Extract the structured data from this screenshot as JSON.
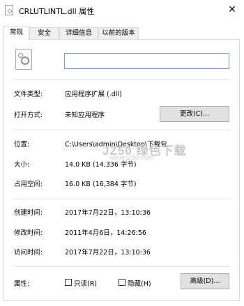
{
  "window": {
    "title": "CRLUTLINTL.dll 属性",
    "close_label": "✕",
    "close_icon": "close-icon"
  },
  "tabs": [
    {
      "label": "常规",
      "active": true
    },
    {
      "label": "安全"
    },
    {
      "label": "详细信息"
    },
    {
      "label": "以前的版本"
    }
  ],
  "general": {
    "file_icon": "settings-file-icon",
    "name_value": "",
    "rows": {
      "type": {
        "label": "文件类型:",
        "value": "应用程序扩展 (.dll)"
      },
      "opens_with": {
        "label": "打开方式:",
        "value": "未知应用程序",
        "button": "更改(C)..."
      },
      "location": {
        "label": "位置:",
        "value": "C:\\Users\\admin\\Desktop\\下载包"
      },
      "size": {
        "label": "大小:",
        "value": "14.0 KB (14,336 字节)"
      },
      "size_on_disk": {
        "label": "占用空间:",
        "value": "16.0 KB (16,384 字节)"
      },
      "created": {
        "label": "创建时间:",
        "value": "2017年7月22日，13:10:36"
      },
      "modified": {
        "label": "修改时间:",
        "value": "2011年4月6日，14:26:56"
      },
      "accessed": {
        "label": "访问时间:",
        "value": "2017年7月22日，13:10:36"
      }
    },
    "attributes": {
      "label": "属性:",
      "readonly": "只读(R)",
      "readonly_checked": false,
      "hidden": "隐藏(H)",
      "hidden_checked": false,
      "advanced_button": "高级(D)..."
    }
  },
  "watermark": {
    "big": "JZ50 绿色下载",
    "small": "www.jz5u.com"
  }
}
